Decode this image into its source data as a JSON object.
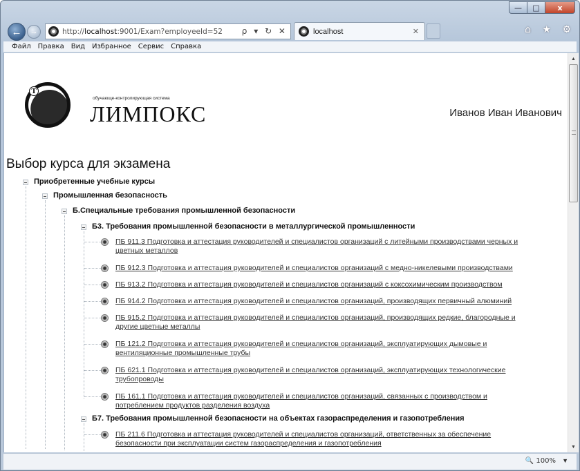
{
  "browser": {
    "url_prefix": "http://",
    "url_host": "localhost",
    "url_rest": ":9001/Exam?employeeId=52",
    "addr_tools": "ρ ▾ ↻ ✕",
    "tab_title": "localhost",
    "tab_close": "✕",
    "right_icons": "⌂ ★ ⚙",
    "back": "←",
    "forward": "→",
    "window_min": "—",
    "window_max": "□",
    "window_close": "x"
  },
  "menu": [
    "Файл",
    "Правка",
    "Вид",
    "Избранное",
    "Сервис",
    "Справка"
  ],
  "status": {
    "zoom": "🔍 100%",
    "zoom_arrow": "▼"
  },
  "scroll": {
    "up": "▲",
    "down": "▼"
  },
  "page": {
    "logo_tagline": "обучающе-контролирующая система",
    "logo_name": "ЛИМПОКС",
    "logo_letter": "Т",
    "user_name": "Иванов Иван Иванович",
    "title": "Выбор курса для экзамена"
  },
  "tree": {
    "root": "Приобретенные учебные курсы",
    "level1": "Промышленная безопасность",
    "level2": "Б.Специальные требования промышленной безопасности",
    "group1": "Б3. Требования промышленной безопасности в металлургической промышленности",
    "group1_items": [
      [
        "ПБ 911.3 Подготовка и аттестация руководителей и специалистов организаций с литейными производствами черных и",
        "цветных металлов"
      ],
      [
        "ПБ 912.3 Подготовка и аттестация руководителей и специалистов организаций с медно-никелевыми производствами"
      ],
      [
        "ПБ 913.2 Подготовка и аттестация руководителей и специалистов организаций с коксохимическим производством"
      ],
      [
        "ПБ 914.2 Подготовка и аттестация руководителей и специалистов организаций, производящих первичный алюминий"
      ],
      [
        "ПБ 915.2 Подготовка и аттестация руководителей и специалистов организаций, производящих редкие, благородные и",
        "другие цветные металлы"
      ],
      [
        "ПБ 121.2 Подготовка и аттестация руководителей и специалистов организаций, эксплуатирующих дымовые и",
        "вентиляционные промышленные трубы"
      ],
      [
        "ПБ 621.1 Подготовка и аттестация руководителей и специалистов организаций, эксплуатирующих технологические",
        "трубопроводы"
      ],
      [
        "ПБ 161.1 Подготовка и аттестация руководителей и специалистов организаций, связанных с производством и",
        "потреблением продуктов разделения воздуха"
      ]
    ],
    "group2": "Б7. Требования промышленной безопасности на объектах газораспределения и газопотребления",
    "group2_items": [
      [
        "ПБ 211.6 Подготовка и аттестация руководителей и специалистов организаций, ответственных за обеспечение",
        "безопасности при эксплуатации систем газораспределения и газопотребления"
      ]
    ]
  }
}
